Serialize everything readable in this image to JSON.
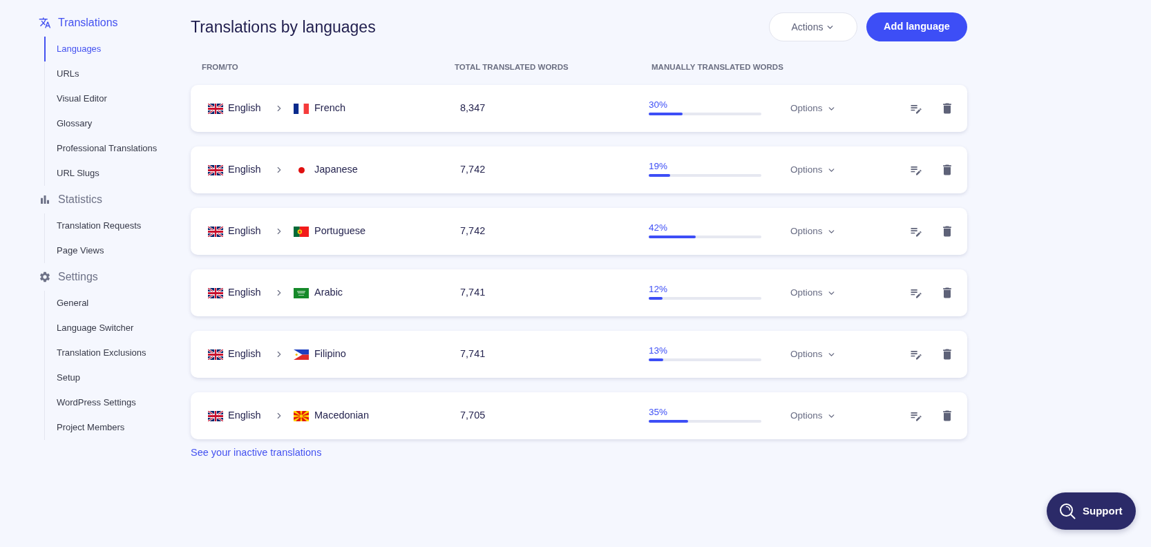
{
  "sidebar": {
    "sections": [
      {
        "title": "Translations",
        "selected": true,
        "items": [
          {
            "label": "Languages",
            "selected": true
          },
          {
            "label": "URLs",
            "selected": false
          },
          {
            "label": "Visual Editor",
            "selected": false
          },
          {
            "label": "Glossary",
            "selected": false
          },
          {
            "label": "Professional Translations",
            "selected": false
          },
          {
            "label": "URL Slugs",
            "selected": false
          }
        ]
      },
      {
        "title": "Statistics",
        "selected": false,
        "items": [
          {
            "label": "Translation Requests",
            "selected": false
          },
          {
            "label": "Page Views",
            "selected": false
          }
        ]
      },
      {
        "title": "Settings",
        "selected": false,
        "items": [
          {
            "label": "General",
            "selected": false
          },
          {
            "label": "Language Switcher",
            "selected": false
          },
          {
            "label": "Translation Exclusions",
            "selected": false
          },
          {
            "label": "Setup",
            "selected": false
          },
          {
            "label": "WordPress Settings",
            "selected": false
          },
          {
            "label": "Project Members",
            "selected": false
          }
        ]
      }
    ]
  },
  "header": {
    "title": "Translations by languages",
    "actions_button": "Actions",
    "add_button": "Add language"
  },
  "table": {
    "columns": [
      "FROM/TO",
      "TOTAL TRANSLATED WORDS",
      "MANUALLY TRANSLATED WORDS"
    ],
    "rows": [
      {
        "source": "English",
        "target": "French",
        "total": "8,347",
        "manual": "30%",
        "level": 0.3,
        "options": "Options"
      },
      {
        "source": "English",
        "target": "Japanese",
        "total": "7,742",
        "manual": "19%",
        "level": 0.19,
        "options": "Options"
      },
      {
        "source": "English",
        "target": "Portuguese",
        "total": "7,742",
        "manual": "42%",
        "level": 0.42,
        "options": "Options"
      },
      {
        "source": "English",
        "target": "Arabic",
        "total": "7,741",
        "manual": "12%",
        "level": 0.12,
        "options": "Options"
      },
      {
        "source": "English",
        "target": "Filipino",
        "total": "7,741",
        "manual": "13%",
        "level": 0.13,
        "options": "Options"
      },
      {
        "source": "English",
        "target": "Macedonian",
        "total": "7,705",
        "manual": "35%",
        "level": 0.35,
        "options": "Options"
      }
    ]
  },
  "inactive_link": "See your inactive translations",
  "support_button": "Support"
}
